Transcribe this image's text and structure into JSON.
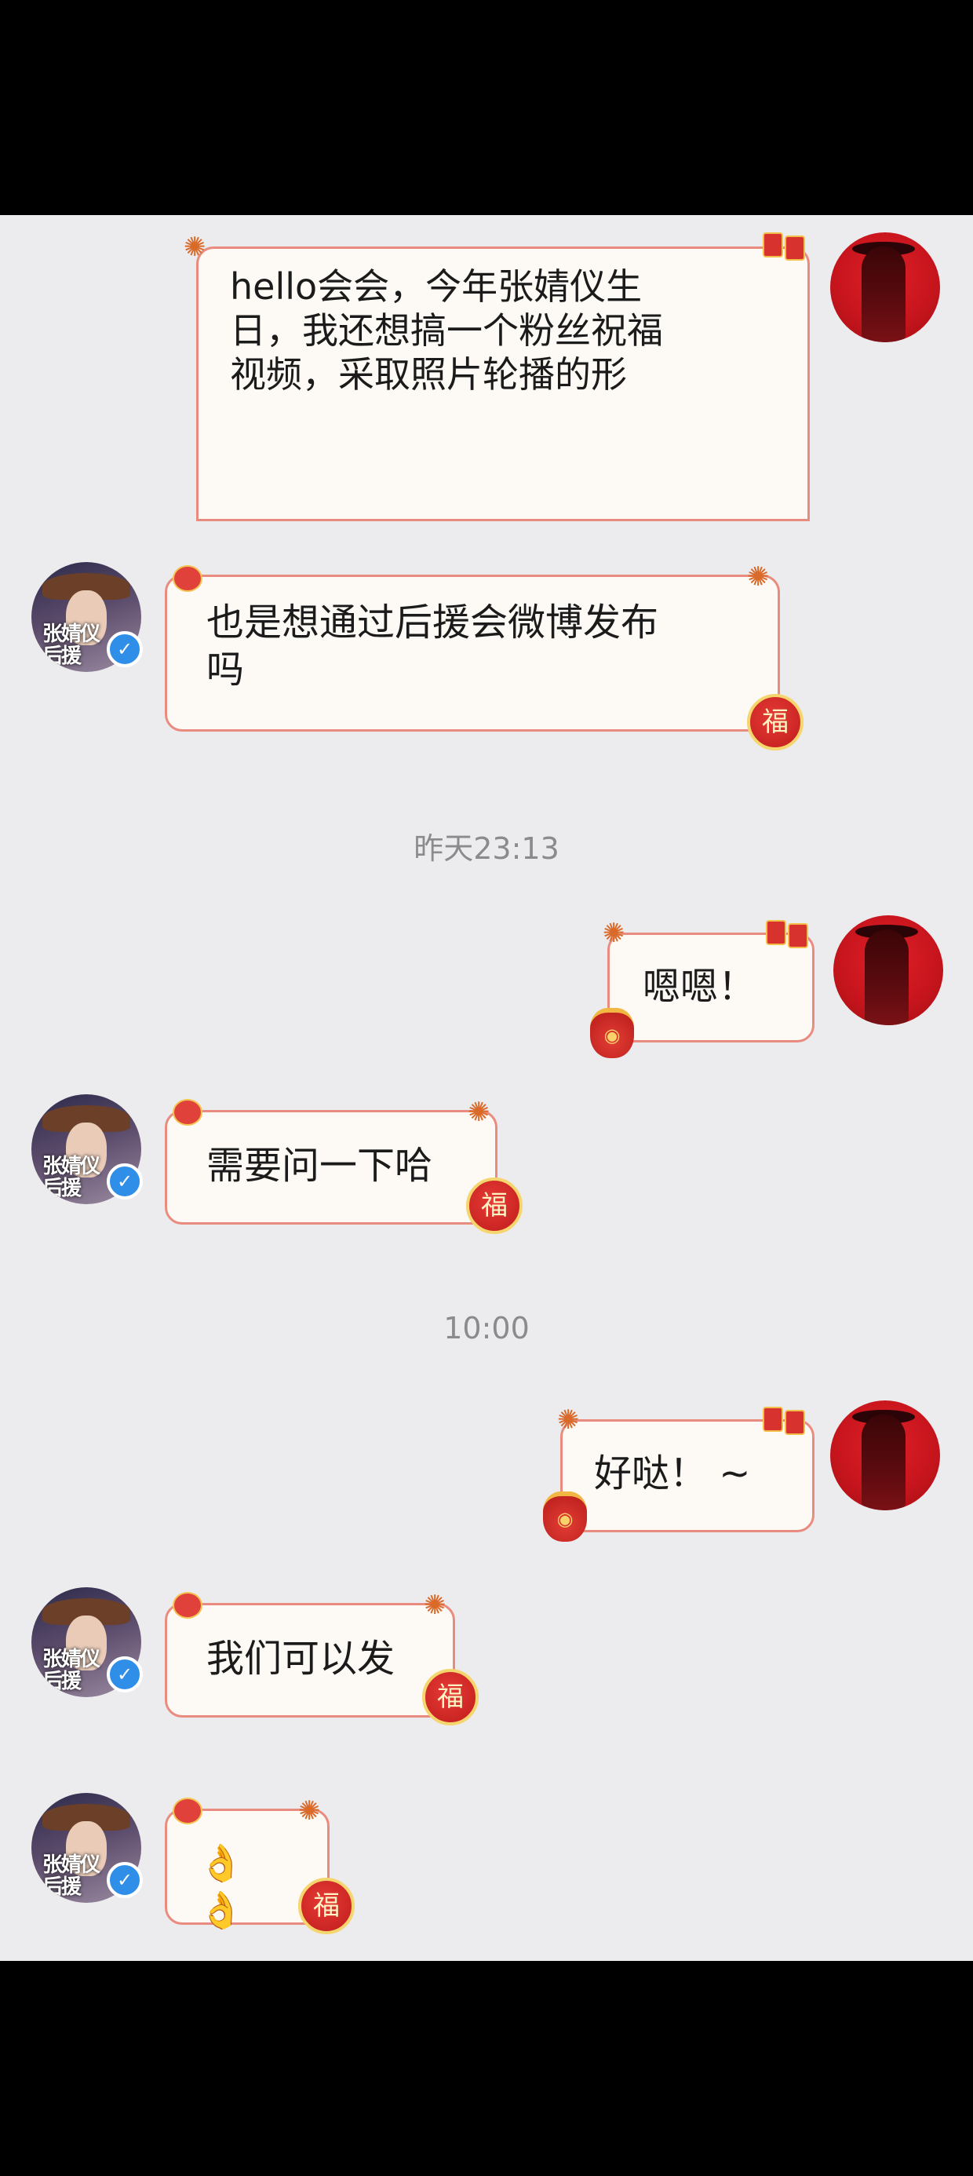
{
  "messages": [
    {
      "side": "me",
      "text": "hello会会，今年张婧仪生\n日，我还想搞一个粉丝祝福\n视频，采取照片轮播的形\n式。\n（↑可以吗🥰）"
    },
    {
      "side": "them",
      "text": "也是想通过后援会微博发布\n吗"
    },
    {
      "side": "time",
      "text": "昨天23:13"
    },
    {
      "side": "me",
      "text": "嗯嗯！"
    },
    {
      "side": "them",
      "text": "需要问一下哈"
    },
    {
      "side": "time",
      "text": "10:00"
    },
    {
      "side": "me",
      "text": "好哒！ ~"
    },
    {
      "side": "them",
      "text": "我们可以发"
    },
    {
      "side": "them",
      "text": "👌👌"
    }
  ],
  "them_avatar": {
    "label_line1": "张婧仪",
    "label_line2": "后援"
  },
  "badge": {
    "fu": "福",
    "verified": "✓"
  },
  "colors": {
    "bubble_border": "#e98b7f",
    "bubble_bg": "#fdf9f4",
    "chat_bg": "#ececee",
    "verified_blue": "#2f8ee8"
  },
  "icons": [
    "firework-icon",
    "red-packet-icon",
    "fu-badge-icon",
    "lucky-bag-icon",
    "verified-icon"
  ]
}
